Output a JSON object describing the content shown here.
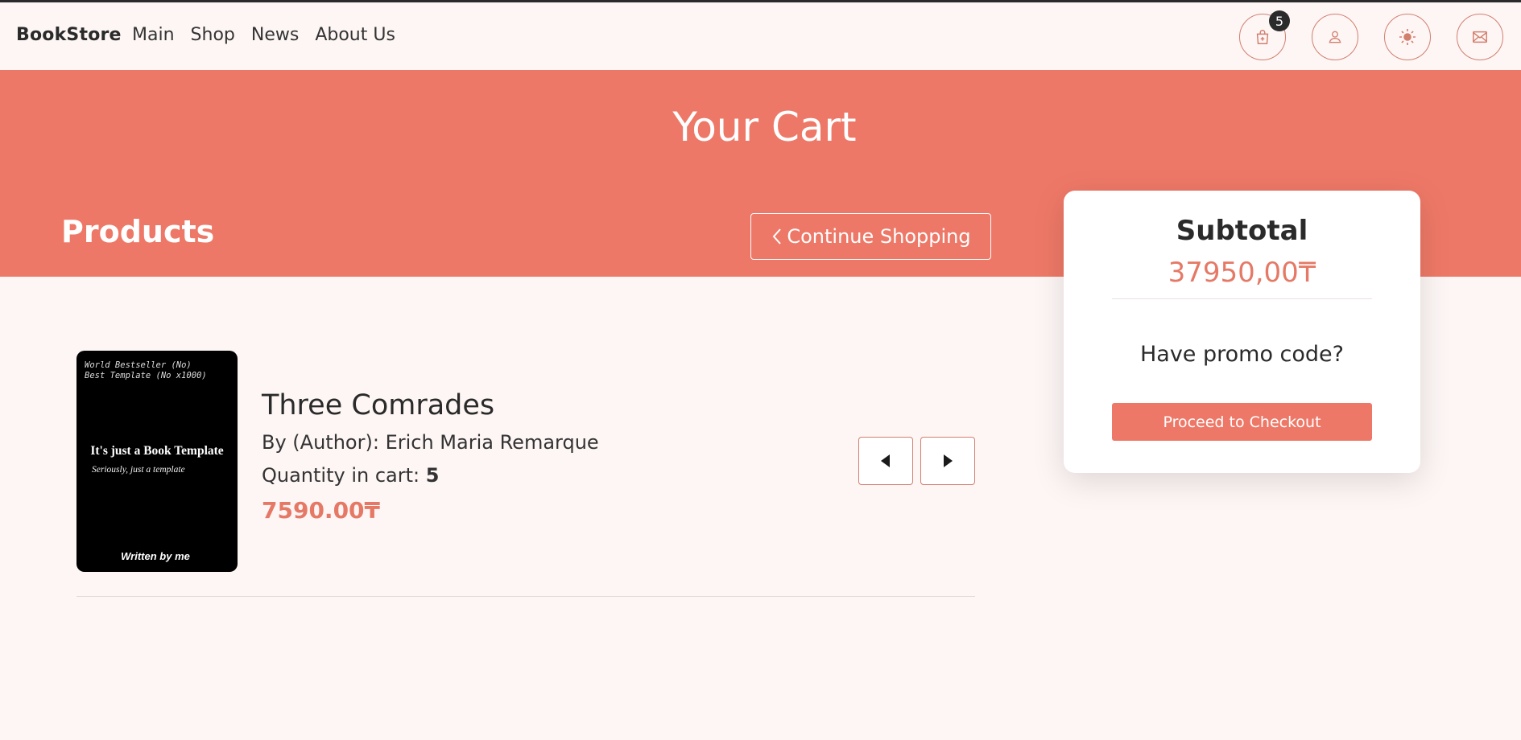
{
  "navbar": {
    "brand": "BookStore",
    "links": [
      "Main",
      "Shop",
      "News",
      "About Us"
    ],
    "cart_badge": "5",
    "icons": [
      "cart-icon",
      "user-icon",
      "sun-icon",
      "mail-icon"
    ]
  },
  "hero": {
    "title": "Your Cart",
    "products_heading": "Products",
    "continue_label": "Continue Shopping"
  },
  "summary": {
    "subtotal_label": "Subtotal",
    "subtotal_value": "37950,00₸",
    "promo_label": "Have promo code?",
    "checkout_label": "Proceed to Checkout"
  },
  "cart_items": [
    {
      "cover": {
        "tagline_1": "World Bestseller (No)",
        "tagline_2": "Best Template (No x1000)",
        "title": "It's just a Book Template",
        "subtitle": "Seriously, just a template",
        "author": "Written by me"
      },
      "title": "Three Comrades",
      "author_label": "By (Author):",
      "author": "Erich Maria Remarque",
      "qty_label": "Quantity in cart:",
      "qty": "5",
      "price": "7590.00₸"
    }
  ],
  "colors": {
    "accent": "#ee7867",
    "price": "#e57966",
    "background": "#fdf6f5",
    "border": "#d37f6e"
  }
}
